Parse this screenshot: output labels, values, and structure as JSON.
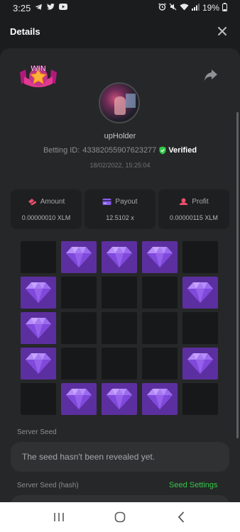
{
  "status_bar": {
    "time": "3:25",
    "battery": "19%",
    "left_icons": [
      "telegram-icon",
      "twitter-icon",
      "youtube-icon"
    ],
    "right_icons": [
      "alarm-icon",
      "mute-icon",
      "wifi-icon",
      "signal-icon",
      "battery-icon"
    ]
  },
  "header": {
    "title": "Details",
    "close_icon": "close-icon"
  },
  "bet": {
    "logo_text": "WIN",
    "username": "upHolder",
    "betting_id_label": "Betting ID:",
    "betting_id": "43382055907623277",
    "verified_label": "Verified",
    "date": "18/02/2022, 15:25:04"
  },
  "stats": [
    {
      "label": "Amount",
      "value": "0.00000010 XLM",
      "icon": "amount-icon",
      "color": "#e8506b"
    },
    {
      "label": "Payout",
      "value": "12.5102 x",
      "icon": "payout-icon",
      "color": "#8a5cf0"
    },
    {
      "label": "Profit",
      "value": "0.00000115 XLM",
      "icon": "profit-icon",
      "color": "#e8506b"
    }
  ],
  "grid": {
    "rows": [
      [
        0,
        1,
        1,
        1,
        0
      ],
      [
        1,
        0,
        0,
        0,
        1
      ],
      [
        1,
        0,
        0,
        0,
        0
      ],
      [
        1,
        0,
        0,
        0,
        1
      ],
      [
        0,
        1,
        1,
        1,
        0
      ]
    ],
    "gem_color": "#5c2fa0",
    "empty_color": "#17181a"
  },
  "server_seed": {
    "label": "Server Seed",
    "value": "The seed hasn't been revealed yet."
  },
  "server_seed_hash": {
    "label": "Server Seed (hash)",
    "settings_link": "Seed Settings"
  },
  "colors": {
    "accent_green": "#35c94a",
    "background": "#1b1c1d",
    "panel": "#262728"
  },
  "nav_bar": {
    "buttons": [
      "recent-apps-icon",
      "home-icon",
      "back-icon"
    ]
  }
}
